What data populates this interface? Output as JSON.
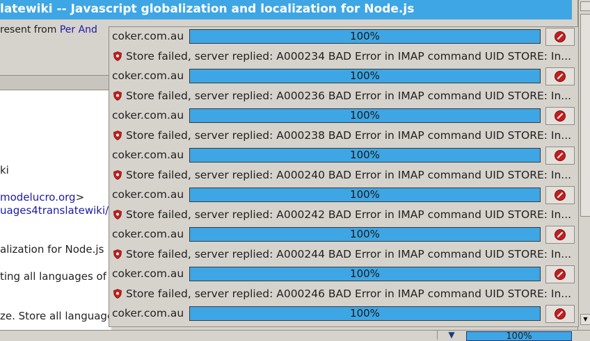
{
  "window": {
    "title": "latewiki -- Javascript globalization and localization for Node.js",
    "header_prefix": "resent from ",
    "header_link": "Per And"
  },
  "body_lines": [
    {
      "text": "ki",
      "link": false
    },
    {
      "text": "modelucro.org",
      "suffix": ">",
      "link": true
    },
    {
      "text": "uages4translatewiki/",
      "link": true
    },
    {
      "text": "alization for Node.js",
      "link": false
    },
    {
      "text": "ting all languages of",
      "link": false
    },
    {
      "text": "ze. Store all language",
      "link": false
    }
  ],
  "bottom_bar": {
    "progress_label": "100%"
  },
  "popup": {
    "rows": [
      {
        "host": "coker.com.au",
        "progress": 100,
        "progress_label": "100%",
        "message": "Store failed, server replied: A000234 BAD Error in IMAP command UID STORE: In..."
      },
      {
        "host": "coker.com.au",
        "progress": 100,
        "progress_label": "100%",
        "message": "Store failed, server replied: A000236 BAD Error in IMAP command UID STORE: In..."
      },
      {
        "host": "coker.com.au",
        "progress": 100,
        "progress_label": "100%",
        "message": "Store failed, server replied: A000238 BAD Error in IMAP command UID STORE: In..."
      },
      {
        "host": "coker.com.au",
        "progress": 100,
        "progress_label": "100%",
        "message": "Store failed, server replied: A000240 BAD Error in IMAP command UID STORE: In..."
      },
      {
        "host": "coker.com.au",
        "progress": 100,
        "progress_label": "100%",
        "message": "Store failed, server replied: A000242 BAD Error in IMAP command UID STORE: In..."
      },
      {
        "host": "coker.com.au",
        "progress": 100,
        "progress_label": "100%",
        "message": "Store failed, server replied: A000244 BAD Error in IMAP command UID STORE: In..."
      },
      {
        "host": "coker.com.au",
        "progress": 100,
        "progress_label": "100%",
        "message": "Store failed, server replied: A000246 BAD Error in IMAP command UID STORE: In..."
      },
      {
        "host": "coker.com.au",
        "progress": 100,
        "progress_label": "100%",
        "message": ""
      }
    ]
  },
  "colors": {
    "accent": "#3ea6e4",
    "error": "#c41f1f",
    "link": "#1a1aa6"
  },
  "icons": {
    "stop": "stop-icon",
    "error": "shield-error-icon",
    "scroll_down": "arrow-down-icon"
  }
}
